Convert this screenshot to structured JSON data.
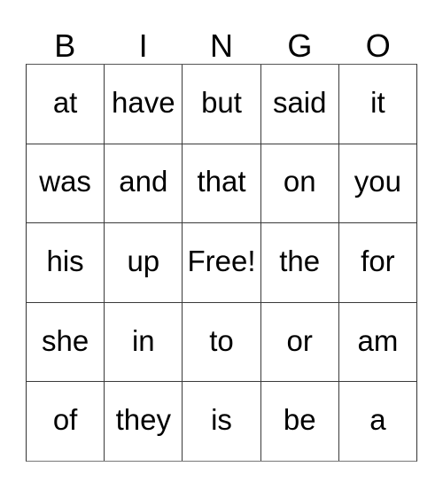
{
  "card": {
    "header": [
      "B",
      "I",
      "N",
      "G",
      "O"
    ],
    "rows": [
      [
        "at",
        "have",
        "but",
        "said",
        "it"
      ],
      [
        "was",
        "and",
        "that",
        "on",
        "you"
      ],
      [
        "his",
        "up",
        "Free!",
        "the",
        "for"
      ],
      [
        "she",
        "in",
        "to",
        "or",
        "am"
      ],
      [
        "of",
        "they",
        "is",
        "be",
        "a"
      ]
    ],
    "free_space": {
      "row": 2,
      "col": 2,
      "label": "Free!"
    },
    "colors": {
      "background": "#ffffff",
      "text": "#000000",
      "grid_line": "#3a3a3a",
      "outer_border": "#333333"
    }
  }
}
